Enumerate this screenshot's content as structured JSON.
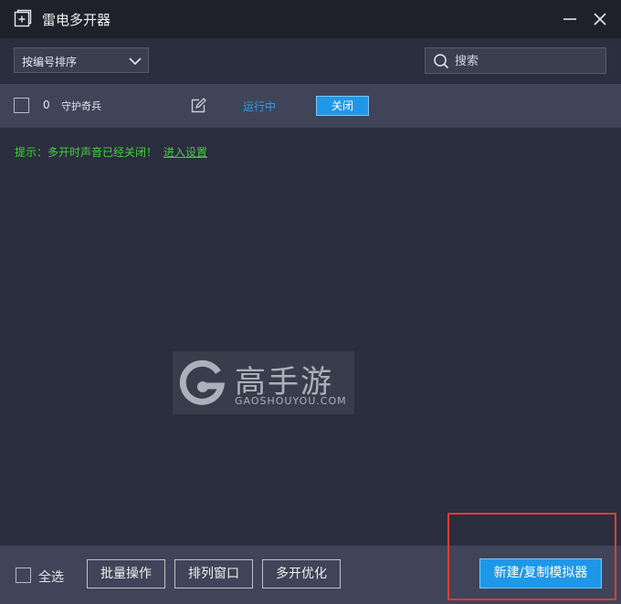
{
  "window": {
    "title": "雷电多开器",
    "icons": {
      "app": "add-window-icon",
      "minimize": "minimize-icon",
      "close": "close-icon"
    }
  },
  "toolbar": {
    "sort_label": "按编号排序",
    "sort_icon": "chevron-down-icon",
    "search_placeholder": "搜索",
    "search_icon": "search-icon"
  },
  "instances": [
    {
      "index": "0",
      "name": "守护奇兵",
      "status": "运行中",
      "action_label": "关闭",
      "edit_icon": "edit-icon"
    }
  ],
  "tip": {
    "text": "提示：多开时声音已经关闭！",
    "link": "进入设置"
  },
  "watermark": {
    "text": "高手游",
    "subtext": "GAOSHOUYOU.COM"
  },
  "footer": {
    "select_all_label": "全选",
    "batch_label": "批量操作",
    "arrange_label": "排列窗口",
    "optimize_label": "多开优化",
    "new_label": "新建/复制模拟器"
  },
  "colors": {
    "background": "#2a2e3e",
    "titlebar": "#1e212b",
    "row": "#3f4458",
    "accent": "#1e97e8",
    "status": "#2aa4ec",
    "tip": "#3fd13a",
    "highlight": "#e03c3c"
  }
}
